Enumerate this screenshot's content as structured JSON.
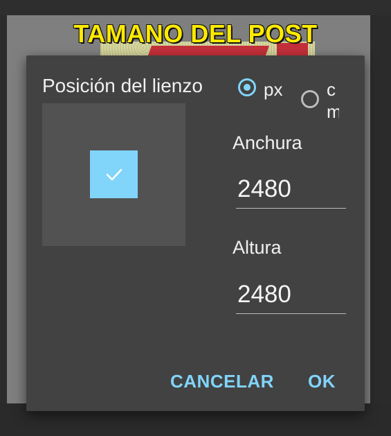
{
  "background": {
    "post_title": "TAMANO DEL POST"
  },
  "dialog": {
    "position_label": "Posición del lienzo",
    "units": {
      "px_label": "px",
      "cm_label": "cm",
      "selected": "px"
    },
    "width_label": "Anchura",
    "width_value": "2480",
    "height_label": "Altura",
    "height_value": "2480",
    "cancel_label": "CANCELAR",
    "ok_label": "OK"
  },
  "colors": {
    "accent": "#81d4fa",
    "dialog_bg": "#424242",
    "title_yellow": "#ffea00"
  },
  "icons": {
    "anchor_check": "check-icon"
  }
}
